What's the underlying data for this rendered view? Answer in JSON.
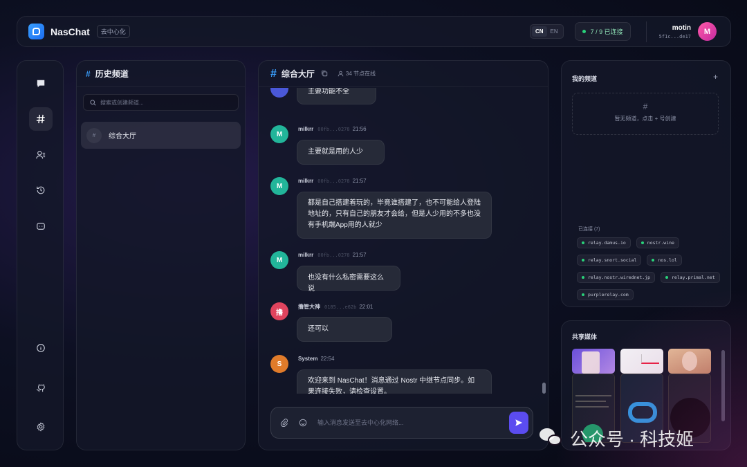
{
  "header": {
    "brand": "NasChat",
    "tag": "去中心化",
    "lang": {
      "cn": "CN",
      "en": "EN",
      "active": "CN"
    },
    "connection_status": "7 / 9 已连接",
    "user": {
      "name": "motin",
      "pubkey": "5f1c...de17",
      "avatar_letter": "M"
    }
  },
  "rail": {
    "icons": [
      "chat-icon",
      "hash-icon",
      "contacts-icon",
      "history-icon",
      "bot-icon",
      "info-icon",
      "github-icon",
      "settings-icon"
    ],
    "active": "hash-icon"
  },
  "channels": {
    "title": "历史频道",
    "search_placeholder": "搜索或创建频道...",
    "items": [
      {
        "badge": "#",
        "name": "综合大厅"
      }
    ]
  },
  "chat": {
    "title": "综合大厅",
    "online": "34 节点在线",
    "messages": [
      {
        "name": "",
        "pub": "",
        "time": "",
        "text": "主要功能不全",
        "avatar": "",
        "color": "#4a58d8"
      },
      {
        "name": "milkrr",
        "pub": "00fb...0278",
        "time": "21:56",
        "text": "主要就是用的人少",
        "avatar": "M",
        "color": "#22b59a"
      },
      {
        "name": "milkrr",
        "pub": "00fb...0278",
        "time": "21:57",
        "text_lines": [
          "都是自己搭建着玩的，毕竟谁搭建了，也不可能给人登陆",
          "地址的，只有自己的朋友才会给，但是人少用的不多也没",
          "有手机端App用的人就少"
        ],
        "avatar": "M",
        "color": "#22b59a"
      },
      {
        "name": "milkrr",
        "pub": "00fb...0278",
        "time": "21:57",
        "text": "也没有什么私密需要这么说",
        "avatar": "M",
        "color": "#22b59a"
      },
      {
        "name": "撸管大神",
        "pub": "0185...e62b",
        "time": "22:01",
        "text": "还可以",
        "avatar": "撸",
        "color": "#e0445e"
      },
      {
        "name": "System",
        "pub": "",
        "time": "22:54",
        "text_lines": [
          "欢迎来到 NasChat！消息通过 Nostr 中继节点同步。如",
          "果连接失败，请检查设置。"
        ],
        "avatar": "S",
        "color": "#e07b2a"
      }
    ],
    "composer_placeholder": "输入消息发送至去中心化网络..."
  },
  "my_channels": {
    "title": "我的频道",
    "add": "+",
    "empty_icon": "#",
    "empty_text": "暂无频道，点击 + 号创建",
    "connected_label": "已连接 (7)",
    "relays": [
      "relay.damus.io",
      "nostr.wine",
      "relay.snort.social",
      "nos.lol",
      "relay.nostr.wirednet.jp",
      "relay.primal.net",
      "purplerelay.com"
    ]
  },
  "shared_media": {
    "title": "共享媒体"
  },
  "watermark": {
    "text": "公众号 · 科技姬"
  },
  "colors": {
    "accent": "#5b4cf0",
    "hash": "#3aa0ff",
    "online": "#29d17a"
  }
}
